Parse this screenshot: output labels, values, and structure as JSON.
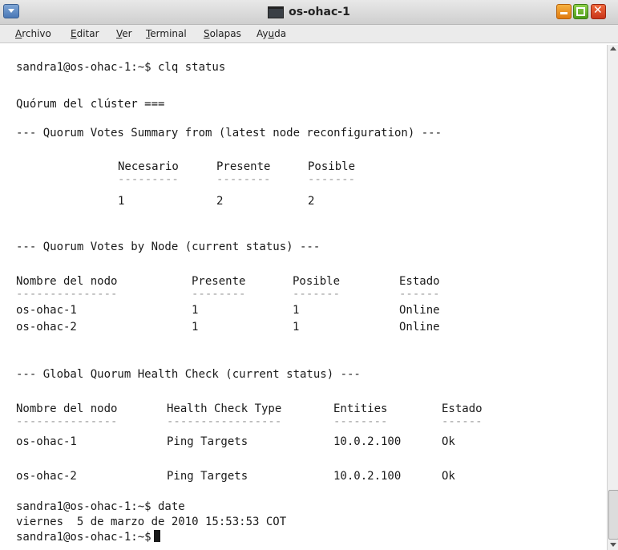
{
  "window": {
    "title": "os-ohac-1"
  },
  "menu": {
    "items": [
      {
        "pre": "",
        "u": "A",
        "post": "rchivo"
      },
      {
        "pre": "",
        "u": "E",
        "post": "ditar"
      },
      {
        "pre": "",
        "u": "V",
        "post": "er"
      },
      {
        "pre": "",
        "u": "T",
        "post": "erminal"
      },
      {
        "pre": "",
        "u": "S",
        "post": "olapas"
      },
      {
        "pre": "Ay",
        "u": "u",
        "post": "da"
      }
    ]
  },
  "terminal": {
    "prompt_cmd1": "sandra1@os-ohac-1:~$ clq status",
    "cluster_heading": "Quórum del clúster ===",
    "summary_header": "--- Quorum Votes Summary from (latest node reconfiguration) ---",
    "summary": {
      "headers": [
        "Necesario",
        "Presente",
        "Posible"
      ],
      "dashes": [
        "---------",
        "--------",
        "-------"
      ],
      "values": [
        "1",
        "2",
        "2"
      ]
    },
    "by_node_header": "--- Quorum Votes by Node (current status) ---",
    "by_node": {
      "headers": [
        "Nombre del nodo",
        "Presente",
        "Posible",
        "Estado"
      ],
      "dashes": [
        "---------------",
        "--------",
        "-------",
        "------"
      ],
      "rows": [
        [
          "os-ohac-1",
          "1",
          "1",
          "Online"
        ],
        [
          "os-ohac-2",
          "1",
          "1",
          "Online"
        ]
      ]
    },
    "health_header": "--- Global Quorum Health Check (current status) ---",
    "health": {
      "headers": [
        "Nombre del nodo",
        "Health Check Type",
        "Entities",
        "Estado"
      ],
      "dashes": [
        "---------------",
        "-----------------",
        "--------",
        "------"
      ],
      "rows": [
        [
          "os-ohac-1",
          "Ping Targets",
          "10.0.2.100",
          "Ok"
        ],
        [
          "os-ohac-2",
          "Ping Targets",
          "10.0.2.100",
          "Ok"
        ]
      ]
    },
    "prompt_cmd2": "sandra1@os-ohac-1:~$ date",
    "date_output": "viernes  5 de marzo de 2010 15:53:53 COT",
    "prompt_final": "sandra1@os-ohac-1:~$"
  }
}
